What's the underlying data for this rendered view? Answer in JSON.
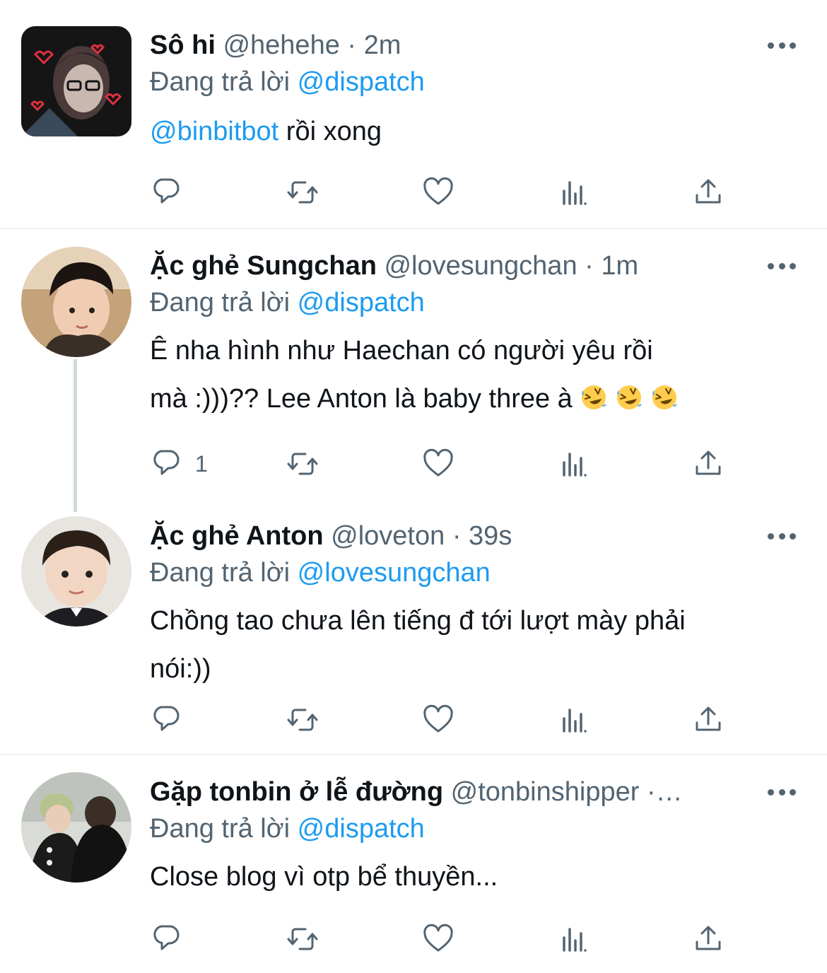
{
  "tweets": [
    {
      "name": "Sô hi",
      "handle": "@hehehe",
      "separator": "·",
      "time": "2m",
      "replying_prefix": "Đang trả lời",
      "replying_to": "@dispatch",
      "mention": "@binbitbot",
      "text": " rồi xong",
      "reply_count": ""
    },
    {
      "name": "Ặc ghẻ Sungchan",
      "handle": "@lovesungchan",
      "separator": "·",
      "time": "1m",
      "replying_prefix": "Đang trả lời",
      "replying_to": "@dispatch",
      "text_line1": "Ê nha hình như Haechan có người yêu rồi",
      "text_line2": "mà :)))?? Lee Anton là baby three à",
      "reply_count": "1"
    },
    {
      "name": "Ặc ghẻ Anton",
      "handle": "@loveton",
      "separator": "·",
      "time": "39s",
      "replying_prefix": "Đang trả lời",
      "replying_to": "@lovesungchan",
      "text_line1": "Chồng tao chưa lên tiếng đ tới lượt mày phải",
      "text_line2": "nói:))",
      "reply_count": ""
    },
    {
      "name": "Gặp tonbin ở lễ đường",
      "handle": "@tonbinshipper",
      "separator": "·…",
      "replying_prefix": "Đang trả lời",
      "replying_to": "@dispatch",
      "text": "Close blog vì otp bể thuyền...",
      "reply_count": ""
    }
  ],
  "icons": {
    "reply": "reply-icon",
    "retweet": "retweet-icon",
    "like": "heart-icon",
    "views": "analytics-icon",
    "share": "share-icon",
    "more": "more-icon",
    "emoji": "rolling-on-floor-laughing-emoji"
  },
  "colors": {
    "text": "#0f1419",
    "secondary": "#536471",
    "link": "#1d9bf0",
    "divider": "#eff3f4",
    "thread_line": "#cfd9de"
  }
}
